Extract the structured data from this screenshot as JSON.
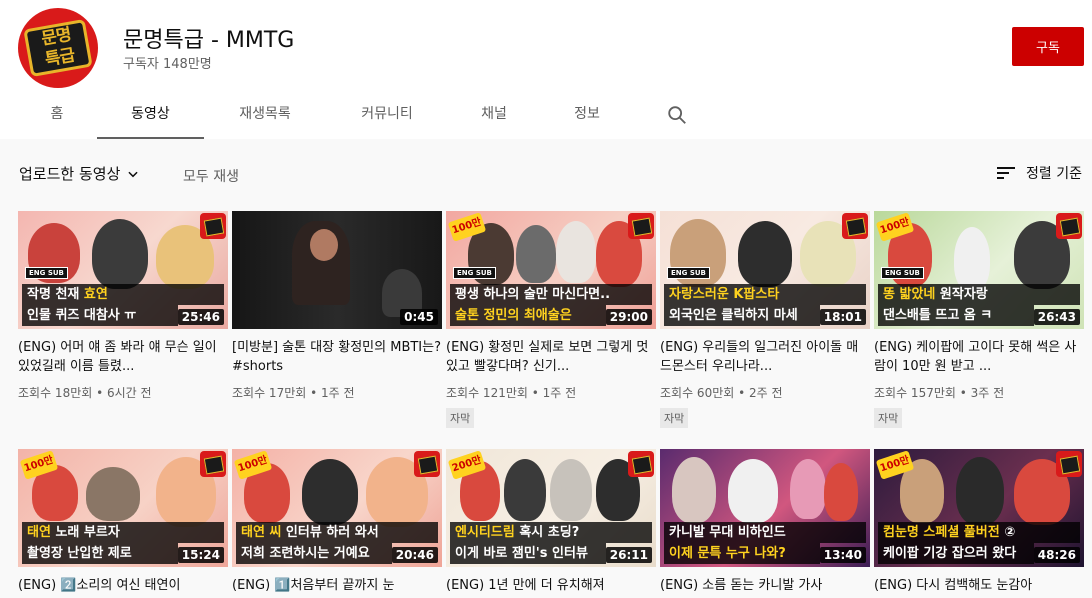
{
  "channel": {
    "avatar_text_1": "문명",
    "avatar_text_2": "특급",
    "title": "문명특급 - MMTG",
    "subscribers": "구독자 148만명",
    "subscribe_label": "구독"
  },
  "tabs": [
    {
      "label": "홈"
    },
    {
      "label": "동영상"
    },
    {
      "label": "재생목록"
    },
    {
      "label": "커뮤니티"
    },
    {
      "label": "채널"
    },
    {
      "label": "정보"
    }
  ],
  "toolbar": {
    "uploads_label": "업로드한 동영상",
    "play_all_label": "모두 재생",
    "sort_label": "정렬 기준"
  },
  "videos": [
    {
      "cap1_pre": "작명 천재 ",
      "cap1_hl": "효연",
      "cap1_post": "",
      "cap2": "인물 퀴즈 대참사 ㅠ",
      "duration": "25:46",
      "badge": "",
      "eng_sub": "ENG SUB",
      "title": "(ENG) 어머 얘 좀 봐라 얘 무슨 일이 있었길래 이름 틀렸...",
      "meta": "조회수 18만회 • 6시간 전",
      "cc": ""
    },
    {
      "cap1_pre": "",
      "cap1_hl": "",
      "cap1_post": "",
      "cap2": "",
      "duration": "0:45",
      "badge": "",
      "eng_sub": "",
      "title": "[미방분] 술톤 대장 황정민의 MBTI는? #shorts",
      "meta": "조회수 17만회 • 1주 전",
      "cc": ""
    },
    {
      "cap1_pre": "평생 하나의 술만 마신다면..",
      "cap1_hl": "",
      "cap1_post": "",
      "cap2": "술톤 정민의 최애술은",
      "duration": "29:00",
      "badge": "100만",
      "eng_sub": "ENG SUB",
      "title": "(ENG) 황정민 실제로 보면 그렇게 멋있고 빨갛다며? 신기...",
      "meta": "조회수 121만회 • 1주 전",
      "cc": "자막"
    },
    {
      "cap1_pre": "",
      "cap1_hl": "자랑스러운 K팝스타",
      "cap1_post": "",
      "cap2": "외국인은 클릭하지 마세",
      "duration": "18:01",
      "badge": "",
      "eng_sub": "ENG SUB",
      "title": "(ENG) 우리들의 일그러진 아이돌 매드몬스터 우리나라...",
      "meta": "조회수 60만회 • 2주 전",
      "cc": "자막"
    },
    {
      "cap1_pre": "",
      "cap1_hl": "똥 밟았네",
      "cap1_post": " 원작자랑",
      "cap2": "댄스배틀 뜨고 옴 ㅋ",
      "duration": "26:43",
      "badge": "100만",
      "eng_sub": "ENG SUB",
      "title": "(ENG) 케이팝에 고이다 못해 썩은 사람이 10만 원 받고 ...",
      "meta": "조회수 157만회 • 3주 전",
      "cc": "자막"
    },
    {
      "cap1_pre": "",
      "cap1_hl": "태연",
      "cap1_post": " 노래 부르자",
      "cap2": "촬영장 난입한 제로",
      "duration": "15:24",
      "badge": "100만",
      "eng_sub": "",
      "title": "(ENG) 2️⃣소리의 여신 태연이",
      "meta": "",
      "cc": ""
    },
    {
      "cap1_pre": "",
      "cap1_hl": "태연 씨",
      "cap1_post": " 인터뷰 하러 와서",
      "cap2": "저희 조련하시는 거예요",
      "duration": "20:46",
      "badge": "100만",
      "eng_sub": "",
      "title": "(ENG) 1️⃣처음부터 끝까지 눈",
      "meta": "",
      "cc": ""
    },
    {
      "cap1_pre": "",
      "cap1_hl": "엔시티드림",
      "cap1_post": " 혹시 초딩?",
      "cap2": "이게 바로 잼민's 인터뷰",
      "duration": "26:11",
      "badge": "200만",
      "eng_sub": "",
      "title": "(ENG) 1년 만에 더 유치해져",
      "meta": "",
      "cc": ""
    },
    {
      "cap1_pre": "카니발 무대 비하인드",
      "cap1_hl": "",
      "cap1_post": "",
      "cap2": "이제 문특 누구 나와?",
      "duration": "13:40",
      "badge": "",
      "eng_sub": "",
      "title": "(ENG) 소름 돋는 카니발 가사",
      "meta": "",
      "cc": ""
    },
    {
      "cap1_pre": "",
      "cap1_hl": "컴눈명 스페셜 풀버전",
      "cap1_post": " ②",
      "cap2": "케이팝 기강 잡으러 왔다",
      "duration": "48:26",
      "badge": "100만",
      "eng_sub": "",
      "title": "(ENG) 다시 컴백해도 눈감아",
      "meta": "",
      "cc": ""
    }
  ],
  "colors": {
    "brand_red": "#cc0000",
    "highlight_yellow": "#ffd21f"
  }
}
